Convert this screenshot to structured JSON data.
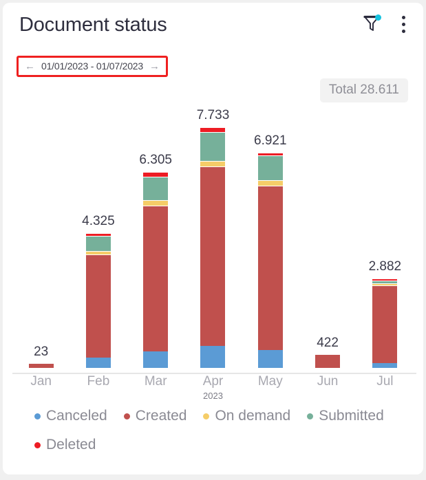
{
  "card": {
    "title": "Document status"
  },
  "header": {
    "filter_icon": "filter-funnel-icon",
    "filter_badge_color": "#16c3e0",
    "menu_icon": "kebab-menu-icon"
  },
  "date_range": {
    "prev_arrow": "←",
    "next_arrow": "→",
    "text": "01/01/2023 - 01/07/2023",
    "highlight_color": "#ef2020"
  },
  "total": {
    "label": "Total 28.611"
  },
  "chart_data": {
    "type": "bar",
    "title": "Document status",
    "stacked": true,
    "xlabel": "2023",
    "ylabel": "",
    "grid": false,
    "legend_position": "bottom",
    "axis_sub_label": "2023",
    "categories": [
      "Jan",
      "Feb",
      "Mar",
      "Apr",
      "May",
      "Jun",
      "Jul"
    ],
    "totals": [
      "23",
      "4.325",
      "6.305",
      "7.733",
      "6.921",
      "422",
      "2.882"
    ],
    "totals_numeric": [
      23,
      4325,
      6305,
      7733,
      6921,
      422,
      2882
    ],
    "ylim": [
      0,
      7733
    ],
    "series": [
      {
        "name": "Canceled",
        "color": "#5b9bd5",
        "values": [
          0,
          330,
          520,
          700,
          570,
          0,
          170
        ]
      },
      {
        "name": "Created",
        "color": "#c0504d",
        "values": [
          23,
          3320,
          4690,
          5770,
          5280,
          422,
          2540
        ]
      },
      {
        "name": "On demand",
        "color": "#f5cd68",
        "values": [
          0,
          110,
          180,
          180,
          180,
          0,
          35
        ]
      },
      {
        "name": "Submitted",
        "color": "#76b09a",
        "values": [
          0,
          480,
          760,
          930,
          800,
          0,
          110
        ]
      },
      {
        "name": "Deleted",
        "color": "#ed1c24",
        "values": [
          0,
          85,
          155,
          153,
          91,
          0,
          27
        ]
      }
    ]
  }
}
